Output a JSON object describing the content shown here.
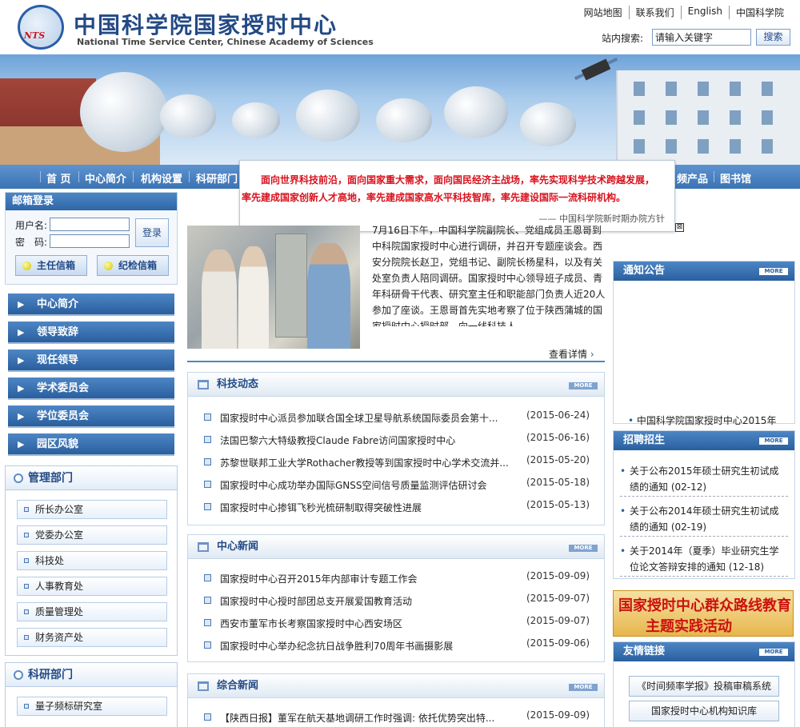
{
  "header": {
    "title_cn": "中国科学院国家授时中心",
    "title_en": "National Time Service Center, Chinese Academy of Sciences",
    "logo_badge": "NTS",
    "top_links": [
      "网站地图",
      "联系我们",
      "English",
      "中国科学院"
    ],
    "search_label": "站内搜索:",
    "search_value": "请输入关键字",
    "search_button": "搜索"
  },
  "nav": {
    "items": [
      "首 页",
      "中心简介",
      "机构设置",
      "科研部门",
      "频产品",
      "图书馆"
    ]
  },
  "popup": {
    "line1": "面向世界科技前沿，面向国家重大需求，面向国民经济主战场，率先实现科学技术跨越发展，",
    "line2": "率先建成国家创新人才高地，率先建成国家高水平科技智库，率先建设国际一流科研机构。",
    "source": "—— 中国科学院新时期办院方针",
    "close": "⊠"
  },
  "mailbox": {
    "title": "邮箱登录",
    "username_label": "用户名:",
    "password_label": "密　码:",
    "login_button": "登录",
    "buttons": [
      "主任信箱",
      "纪检信箱"
    ]
  },
  "left_menu": [
    "中心简介",
    "领导致辞",
    "现任领导",
    "学术委员会",
    "学位委员会",
    "园区风貌"
  ],
  "management": {
    "title": "管理部门",
    "items": [
      "所长办公室",
      "党委办公室",
      "科技处",
      "人事教育处",
      "质量管理处",
      "财务资产处"
    ]
  },
  "research": {
    "title": "科研部门",
    "items": [
      "量子频标研究室"
    ]
  },
  "lead_story": {
    "text": "7月16日下午，中国科学院副院长、党组成员王恩哥到中科院国家授时中心进行调研，并召开专题座谈会。西安分院院长赵卫，党组书记、副院长杨星科，以及有关处室负责人陪同调研。国家授时中心领导班子成员、青年科研骨干代表、研究室主任和职能部门负责人近20人参加了座谈。王恩哥首先实地考察了位于陕西蒲城的国家授时中心授时部，向一线科技人...",
    "more": "查看详情"
  },
  "sections": [
    {
      "title": "科技动态",
      "more": "MORE",
      "items": [
        {
          "title": "国家授时中心派员参加联合国全球卫星导航系统国际委员会第十...",
          "date": "(2015-06-24)"
        },
        {
          "title": "法国巴黎六大特级教授Claude Fabre访问国家授时中心",
          "date": "(2015-06-16)"
        },
        {
          "title": "苏黎世联邦工业大学Rothacher教授等到国家授时中心学术交流并...",
          "date": "(2015-05-20)"
        },
        {
          "title": "国家授时中心成功举办国际GNSS空间信号质量监测评估研讨会",
          "date": "(2015-05-18)"
        },
        {
          "title": "国家授时中心掺铒飞秒光梳研制取得突破性进展",
          "date": "(2015-05-13)"
        }
      ]
    },
    {
      "title": "中心新闻",
      "more": "MORE",
      "items": [
        {
          "title": "国家授时中心召开2015年内部审计专题工作会",
          "date": "(2015-09-09)"
        },
        {
          "title": "国家授时中心授时部团总支开展爱国教育活动",
          "date": "(2015-09-07)"
        },
        {
          "title": "西安市董军市长考察国家授时中心西安场区",
          "date": "(2015-09-07)"
        },
        {
          "title": "国家授时中心举办纪念抗日战争胜利70周年书画摄影展",
          "date": "(2015-09-06)"
        }
      ]
    },
    {
      "title": "综合新闻",
      "more": "MORE",
      "items": [
        {
          "title": "【陕西日报】董军在航天基地调研工作时强调: 依托优势突出特...",
          "date": "(2015-09-09)"
        }
      ]
    }
  ],
  "notice": {
    "title": "通知公告",
    "more": "MORE",
    "items": [
      "中国科学院国家授时中心2015年"
    ]
  },
  "recruit": {
    "title": "招聘招生",
    "more": "MORE",
    "items": [
      {
        "text": "关于公布2015年硕士研究生初试成绩的通知",
        "date": "(02-12)"
      },
      {
        "text": "关于公布2014年硕士研究生初试成绩的通知",
        "date": "(02-19)"
      },
      {
        "text": "关于2014年（夏季）毕业研究生学位论文答辩安排的通知",
        "date": "(12-18)"
      }
    ]
  },
  "promo": {
    "line1": "国家授时中心群众路线教育",
    "line2": "主题实践活动"
  },
  "friends": {
    "title": "友情链接",
    "more": "MORE",
    "items": [
      "《时间频率学报》投稿审稿系统",
      "国家授时中心机构知识库"
    ]
  }
}
